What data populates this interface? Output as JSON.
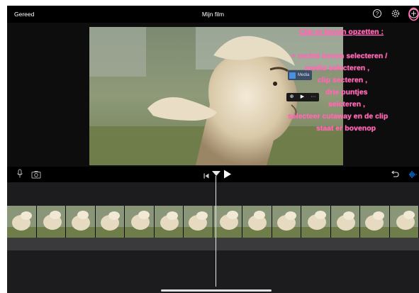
{
  "topbar": {
    "done_label": "Gereed",
    "title": "Mijn film",
    "help_icon": "help-circle-icon",
    "settings_icon": "gear-icon",
    "add_icon": "plus-circle-icon"
  },
  "preview": {
    "media_chip_label": "Media",
    "clip_controls": [
      "⊕",
      "▶",
      "···"
    ]
  },
  "annotation": {
    "heading": "Clip er boven opzetten :",
    "lines": [
      "+ rechts boven selecteren /",
      "media selecteren ,",
      "clip secteren ,",
      "drie puntjes",
      "selcteren ,",
      "selecteer  cutaway en de clip",
      "staat er bovenop"
    ]
  },
  "controls": {
    "mic_icon": "microphone-icon",
    "camera_icon": "camera-icon",
    "rewind_icon": "skip-to-start-icon",
    "play_icon": "play-icon",
    "undo_icon": "undo-icon",
    "audio_icon": "audio-waveform-icon"
  },
  "colors": {
    "annotation": "#ff69b4",
    "accent": "#0a84ff",
    "background": "#000000",
    "timeline": "#1c1c1e"
  }
}
